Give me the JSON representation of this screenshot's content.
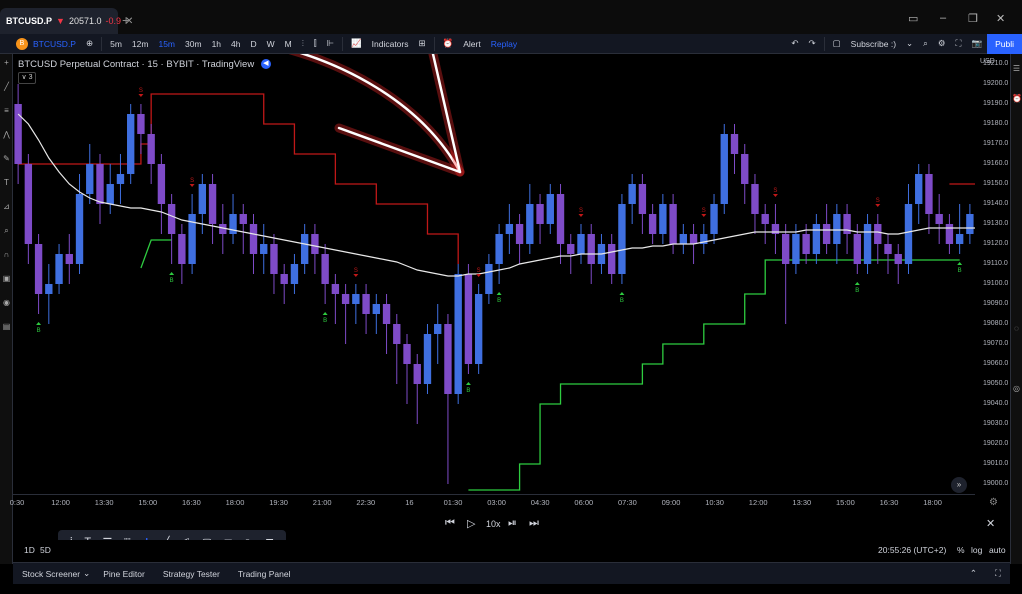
{
  "tab": {
    "symbol": "BTCUSD.P",
    "price": "20571.0",
    "change": "-0.9",
    "close": "✕"
  },
  "new_tab": "+",
  "window": {
    "minimize": "–",
    "maximize": "❐",
    "close": "✕",
    "monitor_icon": "▭"
  },
  "toolbar": {
    "coin_icon": "B",
    "symbol": "BTCUSD.P",
    "add_symbol": "⊕",
    "timeframes": [
      "5m",
      "12m",
      "15m",
      "30m",
      "1h",
      "4h",
      "D",
      "W",
      "M"
    ],
    "active_timeframe": "15m",
    "indicators": "Indicators",
    "alert": "Alert",
    "replay": "Replay",
    "undo": "↶",
    "redo": "↷",
    "subscribe": "Subscribe :)",
    "publish": "Publi"
  },
  "legend": {
    "text": "BTCUSD Perpetual Contract · 15 · BYBIT · TradingView",
    "collapse": "∨ 3",
    "badge": "◀"
  },
  "price_axis": {
    "currency": "USD",
    "labels": [
      "19210.0",
      "19200.0",
      "19190.0",
      "19180.0",
      "19170.0",
      "19160.0",
      "19150.0",
      "19140.0",
      "19130.0",
      "19120.0",
      "19110.0",
      "19100.0",
      "19090.0",
      "19080.0",
      "19070.0",
      "19060.0",
      "19050.0",
      "19040.0",
      "19030.0",
      "19020.0",
      "19010.0",
      "19000.0"
    ]
  },
  "time_axis": {
    "labels": [
      "0:30",
      "12:00",
      "13:30",
      "15:00",
      "16:30",
      "18:00",
      "19:30",
      "21:00",
      "22:30",
      "16",
      "01:30",
      "03:00",
      "04:30",
      "06:00",
      "07:30",
      "09:00",
      "10:30",
      "12:00",
      "13:30",
      "15:00",
      "16:30",
      "18:00"
    ]
  },
  "replay": {
    "step_back": "⏮",
    "play": "▷",
    "speed": "10x",
    "step_fwd": "⏯",
    "to_end": "⏭",
    "close": "✕"
  },
  "status": {
    "ranges": [
      "1D",
      "5D"
    ],
    "clock": "20:55:26 (UTC+2)",
    "percent": "%",
    "log": "log",
    "auto": "auto"
  },
  "panels": [
    "Stock Screener",
    "Pine Editor",
    "Strategy Tester",
    "Trading Panel"
  ],
  "panel_dropdown": "⌄",
  "signals": {
    "buy": "B",
    "sell": "S"
  },
  "colors": {
    "bg": "#000000",
    "bull_candle": "#3f6fe0",
    "bear_candle": "#7e4bc8",
    "ema": "#e8e8e8",
    "trail_up": "#2ecc40",
    "trail_down": "#c01818",
    "accent": "#2962ff",
    "arrow": "#ff2a2a"
  },
  "chart_data": {
    "type": "candlestick",
    "ylim": [
      18995,
      19215
    ],
    "candles": [
      [
        19190,
        19160,
        19200,
        19150
      ],
      [
        19160,
        19120,
        19165,
        19110
      ],
      [
        19120,
        19095,
        19125,
        19085
      ],
      [
        19095,
        19100,
        19110,
        19080
      ],
      [
        19100,
        19115,
        19120,
        19095
      ],
      [
        19115,
        19110,
        19125,
        19100
      ],
      [
        19110,
        19145,
        19155,
        19105
      ],
      [
        19145,
        19160,
        19170,
        19140
      ],
      [
        19160,
        19140,
        19165,
        19130
      ],
      [
        19140,
        19150,
        19160,
        19135
      ],
      [
        19150,
        19155,
        19165,
        19140
      ],
      [
        19155,
        19185,
        19190,
        19150
      ],
      [
        19185,
        19175,
        19190,
        19165
      ],
      [
        19175,
        19160,
        19180,
        19150
      ],
      [
        19160,
        19140,
        19165,
        19125
      ],
      [
        19140,
        19125,
        19145,
        19110
      ],
      [
        19125,
        19110,
        19130,
        19100
      ],
      [
        19110,
        19135,
        19145,
        19105
      ],
      [
        19135,
        19150,
        19155,
        19125
      ],
      [
        19150,
        19130,
        19155,
        19120
      ],
      [
        19130,
        19125,
        19140,
        19115
      ],
      [
        19125,
        19135,
        19145,
        19120
      ],
      [
        19135,
        19130,
        19140,
        19115
      ],
      [
        19130,
        19115,
        19135,
        19105
      ],
      [
        19115,
        19120,
        19130,
        19105
      ],
      [
        19120,
        19105,
        19125,
        19095
      ],
      [
        19105,
        19100,
        19110,
        19090
      ],
      [
        19100,
        19110,
        19115,
        19095
      ],
      [
        19110,
        19125,
        19130,
        19105
      ],
      [
        19125,
        19115,
        19130,
        19105
      ],
      [
        19115,
        19100,
        19120,
        19090
      ],
      [
        19100,
        19095,
        19105,
        19080
      ],
      [
        19095,
        19090,
        19100,
        19070
      ],
      [
        19090,
        19095,
        19100,
        19080
      ],
      [
        19095,
        19085,
        19100,
        19075
      ],
      [
        19085,
        19090,
        19095,
        19075
      ],
      [
        19090,
        19080,
        19095,
        19065
      ],
      [
        19080,
        19070,
        19085,
        19050
      ],
      [
        19070,
        19060,
        19075,
        19040
      ],
      [
        19060,
        19050,
        19065,
        19030
      ],
      [
        19050,
        19075,
        19080,
        19045
      ],
      [
        19075,
        19080,
        19090,
        19060
      ],
      [
        19080,
        19045,
        19085,
        19000
      ],
      [
        19045,
        19105,
        19110,
        19040
      ],
      [
        19105,
        19060,
        19110,
        19055
      ],
      [
        19060,
        19095,
        19100,
        19055
      ],
      [
        19095,
        19110,
        19115,
        19090
      ],
      [
        19110,
        19125,
        19130,
        19100
      ],
      [
        19125,
        19130,
        19140,
        19115
      ],
      [
        19130,
        19120,
        19135,
        19110
      ],
      [
        19120,
        19140,
        19150,
        19115
      ],
      [
        19140,
        19130,
        19145,
        19120
      ],
      [
        19130,
        19145,
        19150,
        19125
      ],
      [
        19145,
        19120,
        19150,
        19110
      ],
      [
        19120,
        19115,
        19125,
        19105
      ],
      [
        19115,
        19125,
        19130,
        19110
      ],
      [
        19125,
        19110,
        19130,
        19100
      ],
      [
        19110,
        19120,
        19125,
        19105
      ],
      [
        19120,
        19105,
        19125,
        19100
      ],
      [
        19105,
        19140,
        19145,
        19100
      ],
      [
        19140,
        19150,
        19155,
        19130
      ],
      [
        19150,
        19135,
        19155,
        19125
      ],
      [
        19135,
        19125,
        19140,
        19120
      ],
      [
        19125,
        19140,
        19145,
        19120
      ],
      [
        19140,
        19120,
        19145,
        19115
      ],
      [
        19120,
        19125,
        19130,
        19115
      ],
      [
        19125,
        19120,
        19130,
        19110
      ],
      [
        19120,
        19125,
        19130,
        19115
      ],
      [
        19125,
        19140,
        19145,
        19120
      ],
      [
        19140,
        19175,
        19180,
        19135
      ],
      [
        19175,
        19165,
        19180,
        19155
      ],
      [
        19165,
        19150,
        19170,
        19140
      ],
      [
        19150,
        19135,
        19155,
        19125
      ],
      [
        19135,
        19130,
        19140,
        19120
      ],
      [
        19130,
        19125,
        19140,
        19115
      ],
      [
        19125,
        19110,
        19130,
        19080
      ],
      [
        19110,
        19125,
        19130,
        19105
      ],
      [
        19125,
        19115,
        19130,
        19110
      ],
      [
        19115,
        19130,
        19135,
        19110
      ],
      [
        19130,
        19120,
        19140,
        19115
      ],
      [
        19120,
        19135,
        19140,
        19110
      ],
      [
        19135,
        19125,
        19140,
        19115
      ],
      [
        19125,
        19110,
        19130,
        19105
      ],
      [
        19110,
        19130,
        19135,
        19105
      ],
      [
        19130,
        19120,
        19135,
        19110
      ],
      [
        19120,
        19115,
        19125,
        19105
      ],
      [
        19115,
        19110,
        19120,
        19100
      ],
      [
        19110,
        19140,
        19150,
        19105
      ],
      [
        19140,
        19155,
        19160,
        19130
      ],
      [
        19155,
        19135,
        19160,
        19125
      ],
      [
        19135,
        19130,
        19145,
        19120
      ],
      [
        19130,
        19120,
        19135,
        19115
      ],
      [
        19120,
        19125,
        19140,
        19115
      ],
      [
        19125,
        19135,
        19140,
        19120
      ]
    ],
    "ema": [
      19185,
      19180,
      19172,
      19163,
      19156,
      19150,
      19146,
      19143,
      19141,
      19140,
      19139,
      19138,
      19138,
      19137,
      19136,
      19134,
      19132,
      19131,
      19130,
      19129,
      19128,
      19127,
      19126,
      19125,
      19124,
      19123,
      19122,
      19121,
      19120,
      19119,
      19118,
      19117,
      19116,
      19115,
      19114,
      19113,
      19112,
      19111,
      19109,
      19107,
      19106,
      19105,
      19104,
      19104,
      19105,
      19105,
      19106,
      19107,
      19108,
      19110,
      19111,
      19112,
      19113,
      19114,
      19114,
      19115,
      19115,
      19115,
      19116,
      19117,
      19118,
      19118,
      19119,
      19119,
      19120,
      19120,
      19120,
      19121,
      19122,
      19123,
      19124,
      19125,
      19126,
      19126,
      19126,
      19126,
      19126,
      19127,
      19127,
      19127,
      19127,
      19127,
      19126,
      19126,
      19126,
      19125,
      19125,
      19126,
      19127,
      19128,
      19128,
      19128,
      19128,
      19128,
      19128
    ],
    "trail": [
      {
        "side": "down",
        "points": [
          [
            0,
            19160
          ],
          [
            12,
            19160
          ],
          [
            12,
            19170
          ],
          [
            13,
            19170
          ],
          [
            13,
            19195
          ],
          [
            24,
            19195
          ],
          [
            24,
            19180
          ],
          [
            27,
            19180
          ],
          [
            27,
            19165
          ],
          [
            31,
            19165
          ],
          [
            31,
            19150
          ],
          [
            35,
            19150
          ],
          [
            35,
            19140
          ],
          [
            40,
            19140
          ],
          [
            40,
            19125
          ],
          [
            43,
            19125
          ],
          [
            43,
            19110
          ]
        ]
      },
      {
        "side": "up",
        "points": [
          [
            12,
            19108
          ],
          [
            13,
            19122
          ],
          [
            15,
            19122
          ]
        ]
      },
      {
        "side": "up",
        "points": [
          [
            44,
            18997
          ],
          [
            49,
            18997
          ],
          [
            49,
            19010
          ],
          [
            51,
            19010
          ],
          [
            51,
            19040
          ],
          [
            53,
            19040
          ],
          [
            53,
            19050
          ],
          [
            61,
            19050
          ],
          [
            61,
            19060
          ],
          [
            63,
            19060
          ],
          [
            63,
            19070
          ],
          [
            67,
            19070
          ],
          [
            67,
            19080
          ],
          [
            71,
            19080
          ],
          [
            71,
            19095
          ],
          [
            73,
            19095
          ],
          [
            73,
            19112
          ],
          [
            92,
            19112
          ]
        ]
      },
      {
        "side": "down",
        "points": [
          [
            91,
            19150
          ],
          [
            94,
            19150
          ]
        ]
      },
      {
        "side": "up",
        "points": [
          [
            95,
            19092
          ],
          [
            96,
            19097
          ],
          [
            99,
            19097
          ]
        ]
      }
    ],
    "buy_signals": [
      2,
      15,
      30,
      44,
      47,
      59,
      82,
      92
    ],
    "sell_signals": [
      12,
      17,
      33,
      45,
      55,
      67,
      74,
      84,
      96
    ]
  }
}
